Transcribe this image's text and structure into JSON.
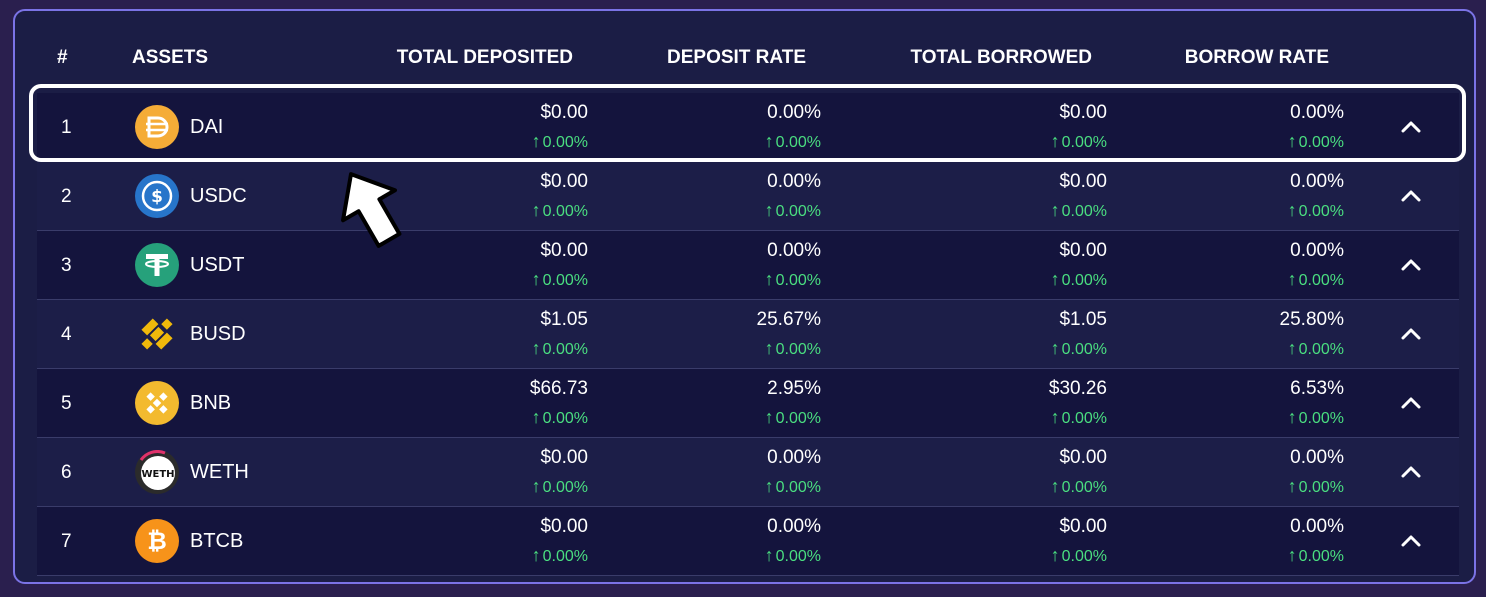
{
  "header": {
    "num": "#",
    "assets": "ASSETS",
    "total_deposited": "TOTAL DEPOSITED",
    "deposit_rate": "DEPOSIT RATE",
    "total_borrowed": "TOTAL BORROWED",
    "borrow_rate": "BORROW RATE"
  },
  "rows": [
    {
      "num": "1",
      "asset": "DAI",
      "icon": "dai-icon",
      "total_deposited": "$0.00",
      "td_change": "0.00%",
      "deposit_rate": "0.00%",
      "dr_change": "0.00%",
      "total_borrowed": "$0.00",
      "tb_change": "0.00%",
      "borrow_rate": "0.00%",
      "br_change": "0.00%"
    },
    {
      "num": "2",
      "asset": "USDC",
      "icon": "usdc-icon",
      "total_deposited": "$0.00",
      "td_change": "0.00%",
      "deposit_rate": "0.00%",
      "dr_change": "0.00%",
      "total_borrowed": "$0.00",
      "tb_change": "0.00%",
      "borrow_rate": "0.00%",
      "br_change": "0.00%"
    },
    {
      "num": "3",
      "asset": "USDT",
      "icon": "usdt-icon",
      "total_deposited": "$0.00",
      "td_change": "0.00%",
      "deposit_rate": "0.00%",
      "dr_change": "0.00%",
      "total_borrowed": "$0.00",
      "tb_change": "0.00%",
      "borrow_rate": "0.00%",
      "br_change": "0.00%"
    },
    {
      "num": "4",
      "asset": "BUSD",
      "icon": "busd-icon",
      "total_deposited": "$1.05",
      "td_change": "0.00%",
      "deposit_rate": "25.67%",
      "dr_change": "0.00%",
      "total_borrowed": "$1.05",
      "tb_change": "0.00%",
      "borrow_rate": "25.80%",
      "br_change": "0.00%"
    },
    {
      "num": "5",
      "asset": "BNB",
      "icon": "bnb-icon",
      "total_deposited": "$66.73",
      "td_change": "0.00%",
      "deposit_rate": "2.95%",
      "dr_change": "0.00%",
      "total_borrowed": "$30.26",
      "tb_change": "0.00%",
      "borrow_rate": "6.53%",
      "br_change": "0.00%"
    },
    {
      "num": "6",
      "asset": "WETH",
      "icon": "weth-icon",
      "total_deposited": "$0.00",
      "td_change": "0.00%",
      "deposit_rate": "0.00%",
      "dr_change": "0.00%",
      "total_borrowed": "$0.00",
      "tb_change": "0.00%",
      "borrow_rate": "0.00%",
      "br_change": "0.00%"
    },
    {
      "num": "7",
      "asset": "BTCB",
      "icon": "btcb-icon",
      "total_deposited": "$0.00",
      "td_change": "0.00%",
      "deposit_rate": "0.00%",
      "dr_change": "0.00%",
      "total_borrowed": "$0.00",
      "tb_change": "0.00%",
      "borrow_rate": "0.00%",
      "br_change": "0.00%"
    }
  ],
  "colors": {
    "panel_bg": "#1b1d45",
    "row_alt_bg": "#14143d",
    "border": "#7b73e6",
    "positive": "#4ade80"
  },
  "coin_icons": {
    "weth_label": "WETH",
    "btcb_glyph": "₿"
  }
}
